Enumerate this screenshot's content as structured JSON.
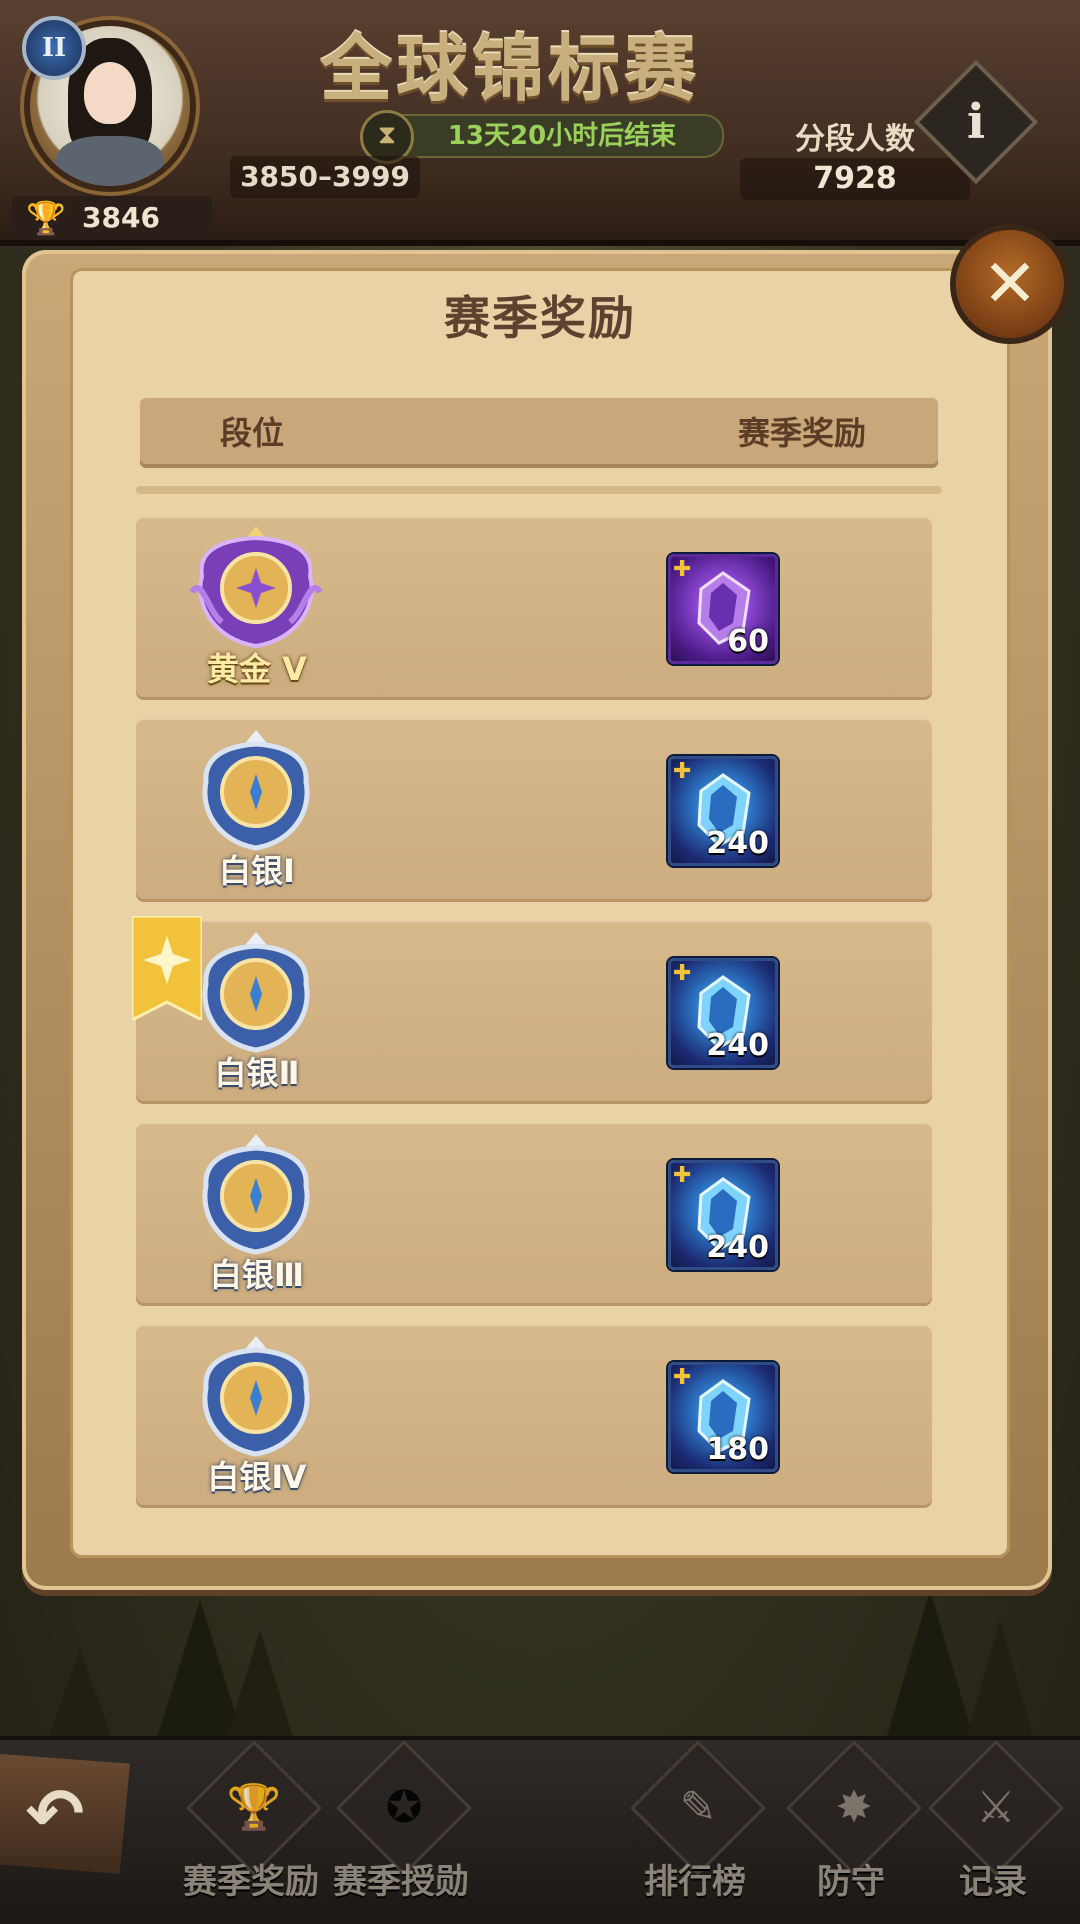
{
  "header": {
    "title": "全球锦标赛",
    "player_rank_badge": "II",
    "trophy_score": "3846",
    "timer_text": "13天20小时后结束",
    "score_range": "3850–3999",
    "tier_count_label": "分段人数",
    "tier_count_value": "7928",
    "info_glyph": "i"
  },
  "modal": {
    "title": "赛季奖励",
    "close_glyph": "✕",
    "columns": {
      "rank": "段位",
      "reward": "赛季奖励"
    },
    "rows": [
      {
        "rank_name": "黄金 V",
        "tier": "gold",
        "reward_type": "purple-shard",
        "reward_qty": "60",
        "current": false
      },
      {
        "rank_name": "白银Ⅰ",
        "tier": "silver",
        "reward_type": "blue-shard",
        "reward_qty": "240",
        "current": false
      },
      {
        "rank_name": "白银Ⅱ",
        "tier": "silver",
        "reward_type": "blue-shard",
        "reward_qty": "240",
        "current": true
      },
      {
        "rank_name": "白银Ⅲ",
        "tier": "silver",
        "reward_type": "blue-shard",
        "reward_qty": "240",
        "current": false
      },
      {
        "rank_name": "白银Ⅳ",
        "tier": "silver",
        "reward_type": "blue-shard",
        "reward_qty": "180",
        "current": false
      }
    ]
  },
  "bottom_nav": {
    "back_glyph": "↶",
    "items": [
      {
        "label": "赛季奖励",
        "icon": "chest-icon"
      },
      {
        "label": "赛季授勋",
        "icon": "medal-icon"
      },
      {
        "label": "排行榜",
        "icon": "scroll-icon"
      },
      {
        "label": "防守",
        "icon": "shield-icon"
      },
      {
        "label": "记录",
        "icon": "record-icon"
      }
    ]
  },
  "colors": {
    "panel": "#e8d2a6",
    "row": "#cdad7f",
    "accent_gold": "#f2c23a",
    "timer_green": "#9bd05a"
  }
}
